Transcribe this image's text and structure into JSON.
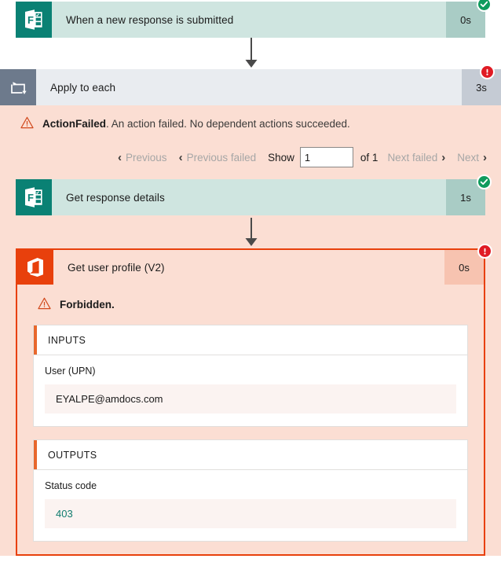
{
  "flow": {
    "trigger": {
      "icon": "microsoft-forms-icon",
      "title": "When a new response is submitted",
      "duration": "0s",
      "status": "succeeded",
      "status_badge": "check-icon"
    },
    "loop": {
      "icon": "apply-to-each-loop-icon",
      "title": "Apply to each",
      "duration": "3s",
      "status": "failed",
      "status_badge": "error-exclamation-icon",
      "error": {
        "icon": "warning-triangle-icon",
        "code": "ActionFailed",
        "message": ". An action failed. No dependent actions succeeded."
      },
      "pager": {
        "previous_label": "Previous",
        "previous_failed_label": "Previous failed",
        "show_label": "Show",
        "page_value": "1",
        "of_label": "of 1",
        "next_failed_label": "Next failed",
        "next_label": "Next",
        "chevron_left": "‹",
        "chevron_right": "›"
      },
      "actions": [
        {
          "icon": "microsoft-forms-icon",
          "title": "Get response details",
          "duration": "1s",
          "status": "succeeded",
          "status_badge": "check-icon"
        },
        {
          "icon": "office-365-users-icon",
          "title": "Get user profile (V2)",
          "duration": "0s",
          "status": "failed",
          "status_badge": "error-exclamation-icon",
          "error": {
            "icon": "warning-triangle-icon",
            "text": "Forbidden."
          },
          "inputs": {
            "section_title": "INPUTS",
            "field_label": "User (UPN)",
            "field_value": "EYALPE@amdocs.com"
          },
          "outputs": {
            "section_title": "OUTPUTS",
            "field_label": "Status code",
            "field_value": "403"
          }
        }
      ]
    }
  },
  "colors": {
    "success_icon": "#0a8174",
    "success_body": "#cfe5e0",
    "success_duration": "#a9ccc5",
    "loop_icon": "#6d7a8c",
    "loop_body": "#e9ecf0",
    "loop_duration": "#c5cbd4",
    "fail_icon": "#e8400c",
    "fail_body": "#fbded3",
    "fail_duration": "#f7c3b0",
    "badge_ok": "#0f9b5d",
    "badge_err": "#e01b24",
    "section_bar": "#e8672c",
    "code_text": "#107c6e"
  }
}
